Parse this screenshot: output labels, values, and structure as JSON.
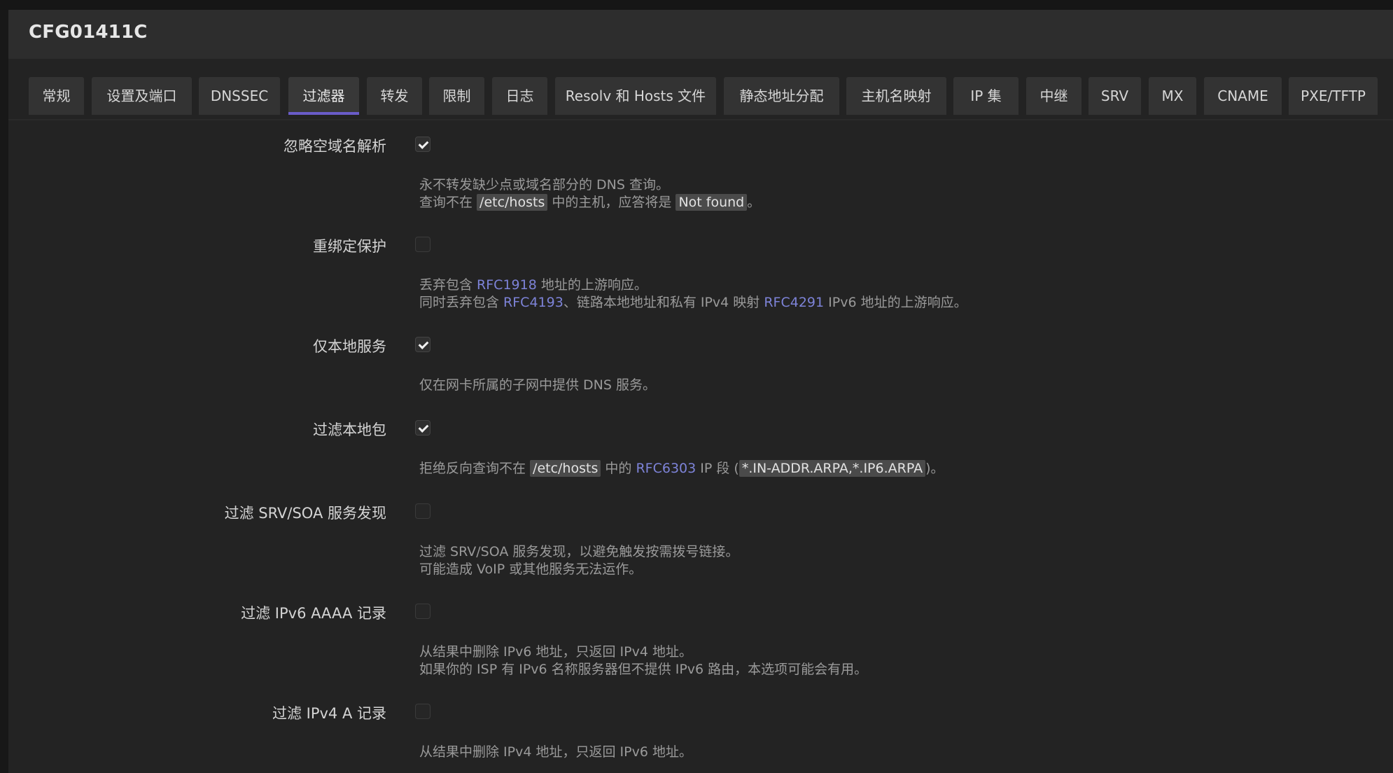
{
  "panel": {
    "title": "CFG01411C"
  },
  "tabs": [
    {
      "label": "常规",
      "active": false
    },
    {
      "label": "设置及端口",
      "active": false
    },
    {
      "label": "DNSSEC",
      "active": false
    },
    {
      "label": "过滤器",
      "active": true
    },
    {
      "label": "转发",
      "active": false
    },
    {
      "label": "限制",
      "active": false
    },
    {
      "label": "日志",
      "active": false
    },
    {
      "label": "Resolv 和 Hosts 文件",
      "active": false
    },
    {
      "label": "静态地址分配",
      "active": false
    },
    {
      "label": "主机名映射",
      "active": false
    },
    {
      "label": "IP 集",
      "active": false
    },
    {
      "label": "中继",
      "active": false
    },
    {
      "label": "SRV",
      "active": false
    },
    {
      "label": "MX",
      "active": false
    },
    {
      "label": "CNAME",
      "active": false
    },
    {
      "label": "PXE/TFTP",
      "active": false
    }
  ],
  "options": {
    "domain_needed": {
      "label": "忽略空域名解析",
      "checked": true,
      "desc": {
        "line1": "永不转发缺少点或域名部分的 DNS 查询。",
        "line2_a": "查询不在 ",
        "line2_code1": "/etc/hosts",
        "line2_b": " 中的主机，应答将是 ",
        "line2_code2": "Not found",
        "line2_c": "。"
      }
    },
    "rebind_protection": {
      "label": "重绑定保护",
      "checked": false,
      "desc": {
        "line1_a": "丢弃包含 ",
        "line1_link": "RFC1918",
        "line1_b": " 地址的上游响应。",
        "line2_a": "同时丢弃包含 ",
        "line2_link1": "RFC4193",
        "line2_b": "、链路本地地址和私有 IPv4 映射 ",
        "line2_link2": "RFC4291",
        "line2_c": " IPv6 地址的上游响应。"
      }
    },
    "local_service": {
      "label": "仅本地服务",
      "checked": true,
      "desc": {
        "line1": "仅在网卡所属的子网中提供 DNS 服务。"
      }
    },
    "bogus_priv": {
      "label": "过滤本地包",
      "checked": true,
      "desc": {
        "a": "拒绝反向查询不在 ",
        "code1": "/etc/hosts",
        "b": " 中的 ",
        "link": "RFC6303",
        "c": " IP 段 (",
        "code2": "*.IN-ADDR.ARPA,*.IP6.ARPA",
        "d": ")。"
      }
    },
    "filterwin2k": {
      "label": "过滤 SRV/SOA 服务发现",
      "checked": false,
      "desc": {
        "line1": "过滤 SRV/SOA 服务发现，以避免触发按需拨号链接。",
        "line2": "可能造成 VoIP 或其他服务无法运作。"
      }
    },
    "filter_aaaa": {
      "label": "过滤 IPv6 AAAA 记录",
      "checked": false,
      "desc": {
        "line1": "从结果中删除 IPv6 地址，只返回 IPv4 地址。",
        "line2": "如果你的 ISP 有 IPv6 名称服务器但不提供 IPv6 路由，本选项可能会有用。"
      }
    },
    "filter_a": {
      "label": "过滤 IPv4 A 记录",
      "checked": false,
      "desc": {
        "line1": "从结果中删除 IPv4 地址，只返回 IPv6 地址。"
      }
    }
  },
  "colors": {
    "accent": "#6a5cc9",
    "link": "#7d83d8",
    "background": "#232323"
  }
}
